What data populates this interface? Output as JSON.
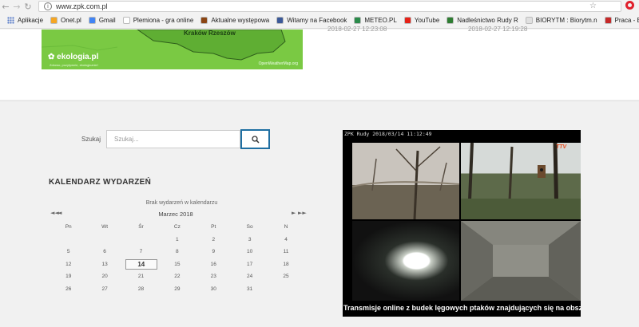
{
  "browser": {
    "url": "www.zpk.com.pl",
    "bookmarks": [
      {
        "label": "Aplikacje",
        "icon": "apps-icon",
        "color": "#5a7dc8"
      },
      {
        "label": "Onet.pl",
        "icon": "onet-icon",
        "color": "#f5a623"
      },
      {
        "label": "Gmail",
        "icon": "google-icon",
        "color": "#4285f4"
      },
      {
        "label": "Plemiona - gra online",
        "icon": "plemiona-icon",
        "color": "#ffffff"
      },
      {
        "label": "Aktualne występowa",
        "icon": "aktualne-icon",
        "color": "#8b4513"
      },
      {
        "label": "Witamy na Facebook",
        "icon": "facebook-icon",
        "color": "#3b5998"
      },
      {
        "label": "METEO.PL",
        "icon": "meteo-icon",
        "color": "#2a8a4a"
      },
      {
        "label": "YouTube",
        "icon": "youtube-icon",
        "color": "#e62117"
      },
      {
        "label": "Nadleśnictwo Rudy R",
        "icon": "nadlesnictwo-icon",
        "color": "#2e7d32"
      },
      {
        "label": "BIORYTM : Biorytm.n",
        "icon": "document-icon",
        "color": "#e0e0e0"
      },
      {
        "label": "Praca - Biuletyn Infor",
        "icon": "praca-icon",
        "color": "#c62828"
      }
    ]
  },
  "map": {
    "cities": [
      "Kraków",
      "Rzeszów"
    ],
    "logo": "ekologia.pl",
    "slogan": "Zdrowo, pozytywnie, ekologicznie!",
    "credit": "OpenWeatherMap.org",
    "color": "#7ac943"
  },
  "timestamps": [
    "2018-02-27 12:23:08",
    "2018-02-27 12:19:28"
  ],
  "search": {
    "label": "Szukaj",
    "placeholder": "Szukaj..."
  },
  "calendar": {
    "title": "KALENDARZ WYDARZEŃ",
    "empty_message": "Brak wydarzeń w kalendarzu",
    "month": "Marzec 2018",
    "nav": {
      "first": "◄◄",
      "prev": "◄",
      "next": "►",
      "last": "►►"
    },
    "weekdays": [
      "Pn",
      "Wt",
      "Śr",
      "Cz",
      "Pt",
      "So",
      "N"
    ],
    "rows": [
      [
        "",
        "",
        "",
        "1",
        "2",
        "3",
        "4"
      ],
      [
        "5",
        "6",
        "7",
        "8",
        "9",
        "10",
        "11"
      ],
      [
        "12",
        "13",
        "14",
        "15",
        "16",
        "17",
        "18"
      ],
      [
        "19",
        "20",
        "21",
        "22",
        "23",
        "24",
        "25"
      ],
      [
        "26",
        "27",
        "28",
        "29",
        "30",
        "31",
        ""
      ]
    ],
    "today": "14"
  },
  "webcam": {
    "header": "ZPK Rudy 2018/03/14 11:12:49",
    "caption": "Transmisje online z budek lęgowych ptaków znajdujących się na obszarze O",
    "logo": "TTV"
  }
}
